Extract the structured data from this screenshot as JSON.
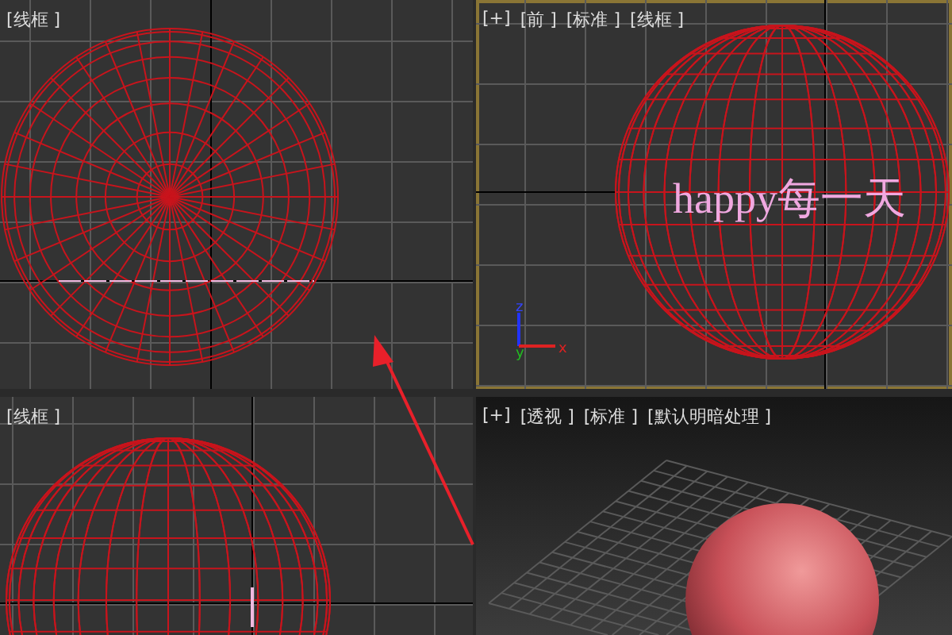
{
  "viewports": [
    {
      "kind": "top",
      "active": false,
      "labels": [
        "[线框 ]"
      ]
    },
    {
      "kind": "front",
      "active": true,
      "labels": [
        "[+]",
        "[前 ]",
        "[标准 ]",
        "[线框 ]"
      ],
      "scene_text": "happy每一天",
      "axis_labels": [
        "z",
        "y",
        "x"
      ]
    },
    {
      "kind": "side",
      "active": false,
      "labels": [
        "[线框 ]"
      ]
    },
    {
      "kind": "perspective",
      "active": false,
      "labels": [
        "[+]",
        "[透视 ]",
        "[标准 ]",
        "[默认明暗处理 ]"
      ]
    }
  ]
}
